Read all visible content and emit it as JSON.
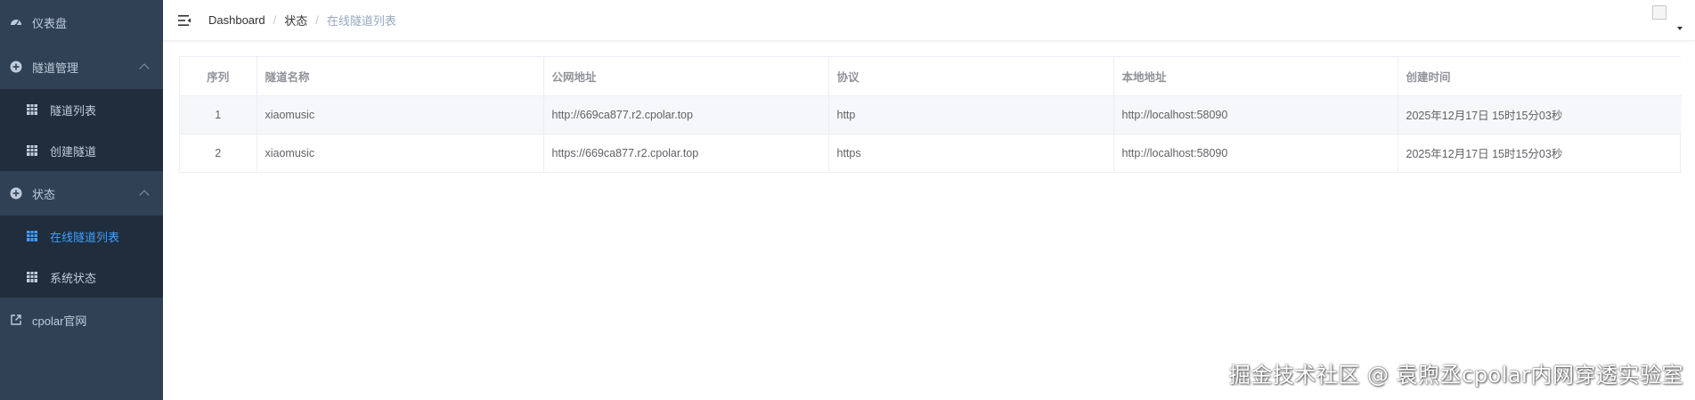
{
  "colors": {
    "sidebar_bg": "#304156",
    "submenu_bg": "#1f2d3d",
    "sidebar_text": "#bfcbd9",
    "active_text": "#409eff",
    "table_border": "#ebeef5"
  },
  "sidebar": {
    "dashboard": {
      "label": "仪表盘",
      "icon": "dashboard-icon"
    },
    "tunnel_mgmt": {
      "label": "隧道管理",
      "icon": "plus-circle-icon",
      "expanded": true,
      "items": [
        {
          "label": "隧道列表",
          "icon": "table-icon",
          "active": false
        },
        {
          "label": "创建隧道",
          "icon": "table-icon",
          "active": false
        }
      ]
    },
    "status": {
      "label": "状态",
      "icon": "plus-circle-icon",
      "expanded": true,
      "items": [
        {
          "label": "在线隧道列表",
          "icon": "table-icon",
          "active": true
        },
        {
          "label": "系统状态",
          "icon": "table-icon",
          "active": false
        }
      ]
    },
    "website": {
      "label": "cpolar官网",
      "icon": "external-link-icon"
    }
  },
  "navbar": {
    "breadcrumb": [
      "Dashboard",
      "状态",
      "在线隧道列表"
    ]
  },
  "table": {
    "headers": [
      "序列",
      "隧道名称",
      "公网地址",
      "协议",
      "本地地址",
      "创建时间"
    ],
    "rows": [
      [
        "1",
        "xiaomusic",
        "http://669ca877.r2.cpolar.top",
        "http",
        "http://localhost:58090",
        "2025年12月17日 15时15分03秒"
      ],
      [
        "2",
        "xiaomusic",
        "https://669ca877.r2.cpolar.top",
        "https",
        "http://localhost:58090",
        "2025年12月17日 15时15分03秒"
      ]
    ]
  },
  "watermark": "掘金技术社区 @ 袁煦丞cpolar内网穿透实验室"
}
